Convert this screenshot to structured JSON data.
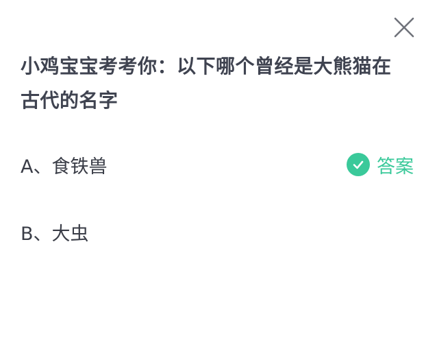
{
  "question": {
    "line1": "小鸡宝宝考考你：以下哪个曾经是大熊猫在",
    "line2": "古代的名字"
  },
  "options": [
    {
      "label": "A、食铁兽",
      "is_answer": true
    },
    {
      "label": "B、大虫",
      "is_answer": false
    }
  ],
  "answer_badge": {
    "label": "答案",
    "icon": "check-circle-icon",
    "color": "#3ac99a"
  },
  "close": {
    "icon": "close-icon"
  }
}
